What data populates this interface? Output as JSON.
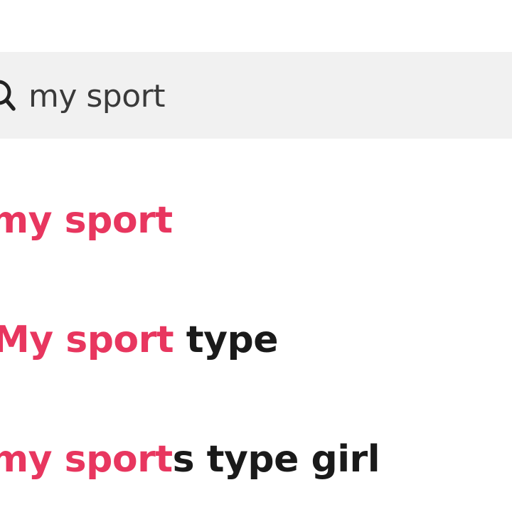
{
  "search": {
    "query": "my sport",
    "icon": "search-icon"
  },
  "suggestions": [
    {
      "highlight": "my sport",
      "rest": ""
    },
    {
      "highlight": "My sport",
      "rest": " type"
    },
    {
      "highlight": "my sport",
      "rest": "s type girl"
    }
  ],
  "colors": {
    "highlight": "#e8365f",
    "text": "#1a1a1a",
    "search_bg": "#f1f1f1",
    "search_text": "#3a3a3a"
  }
}
